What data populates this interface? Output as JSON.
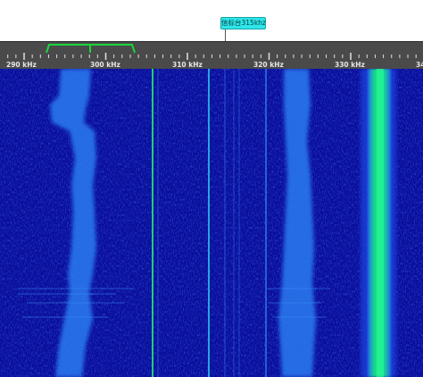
{
  "marker": {
    "label": "信标台315khz"
  },
  "ruler": {
    "freq_labels": [
      "290 kHz",
      "300 kHz",
      "310 kHz",
      "320 kHz",
      "330 kHz",
      "34"
    ],
    "bandwidth_color": "#19d63a"
  },
  "colors": {
    "background": "#0a0e9a",
    "signal": "#2a7cf0",
    "strong_signal": "#18e878",
    "ruler": "#4a4a4a"
  },
  "waterfall": {
    "icon": "spectrum-waterfall-icon"
  }
}
